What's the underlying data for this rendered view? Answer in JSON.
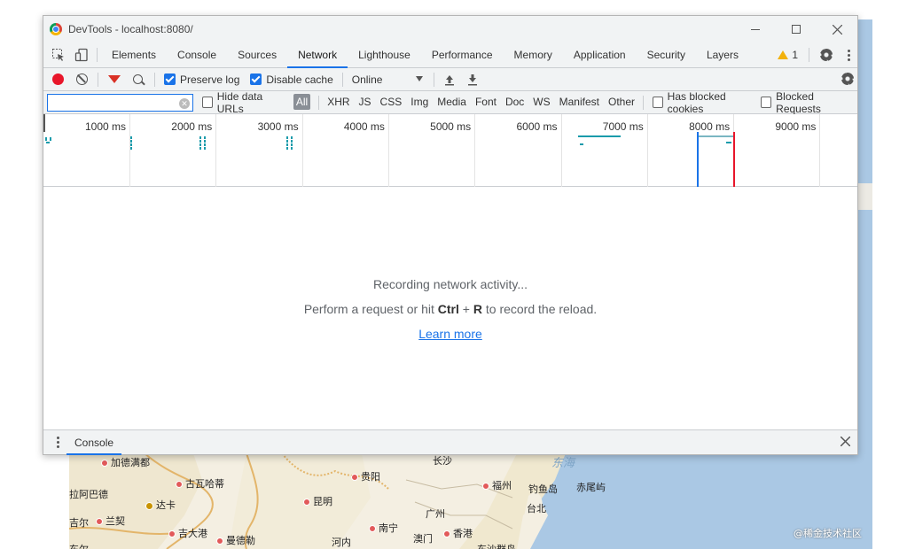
{
  "window": {
    "title": "DevTools - localhost:8080/"
  },
  "tabs": [
    {
      "label": "Elements"
    },
    {
      "label": "Console"
    },
    {
      "label": "Sources"
    },
    {
      "label": "Network",
      "active": true
    },
    {
      "label": "Lighthouse"
    },
    {
      "label": "Performance"
    },
    {
      "label": "Memory"
    },
    {
      "label": "Application"
    },
    {
      "label": "Security"
    },
    {
      "label": "Layers"
    }
  ],
  "warnings": {
    "count": "1"
  },
  "toolbar": {
    "preserve_log_label": "Preserve log",
    "preserve_log_checked": true,
    "disable_cache_label": "Disable cache",
    "disable_cache_checked": true,
    "throttling_value": "Online"
  },
  "filter": {
    "input_value": "",
    "hide_data_urls_label": "Hide data URLs",
    "types": [
      "All",
      "XHR",
      "JS",
      "CSS",
      "Img",
      "Media",
      "Font",
      "Doc",
      "WS",
      "Manifest",
      "Other"
    ],
    "active_type": "All",
    "has_blocked_cookies_label": "Has blocked cookies",
    "blocked_requests_label": "Blocked Requests"
  },
  "timeline": {
    "ticks": [
      "1000 ms",
      "2000 ms",
      "3000 ms",
      "4000 ms",
      "5000 ms",
      "6000 ms",
      "7000 ms",
      "8000 ms",
      "9000 ms"
    ]
  },
  "empty_state": {
    "line1": "Recording network activity...",
    "line2_prefix": "Perform a request or hit ",
    "line2_key1": "Ctrl",
    "line2_plus": " + ",
    "line2_key2": "R",
    "line2_suffix": " to record the reload.",
    "learn_more": "Learn more"
  },
  "drawer": {
    "tab_label": "Console"
  },
  "map": {
    "labels": [
      {
        "text": "加德满都",
        "kind": "cap"
      },
      {
        "text": "古瓦哈蒂",
        "kind": "cap"
      },
      {
        "text": "拉阿巴德",
        "kind": "plain"
      },
      {
        "text": "达卡",
        "kind": "capital"
      },
      {
        "text": "吉尔",
        "kind": "plain"
      },
      {
        "text": "兰契",
        "kind": "cap"
      },
      {
        "text": "吉大港",
        "kind": "cap"
      },
      {
        "text": "曼德勒",
        "kind": "cap"
      },
      {
        "text": "东尔",
        "kind": "plain"
      },
      {
        "text": "贵阳",
        "kind": "cap"
      },
      {
        "text": "昆明",
        "kind": "cap"
      },
      {
        "text": "南宁",
        "kind": "cap"
      },
      {
        "text": "河内",
        "kind": "plain"
      },
      {
        "text": "广州",
        "kind": "plain"
      },
      {
        "text": "澳门",
        "kind": "plain"
      },
      {
        "text": "香港",
        "kind": "cap"
      },
      {
        "text": "长沙",
        "kind": "plain"
      },
      {
        "text": "福州",
        "kind": "cap"
      },
      {
        "text": "钓鱼岛",
        "kind": "plain"
      },
      {
        "text": "赤尾屿",
        "kind": "plain"
      },
      {
        "text": "台北",
        "kind": "plain"
      },
      {
        "text": "东沙群岛",
        "kind": "plain"
      },
      {
        "text": "东海",
        "kind": "sea"
      }
    ],
    "watermark": "@稀金技术社区"
  }
}
